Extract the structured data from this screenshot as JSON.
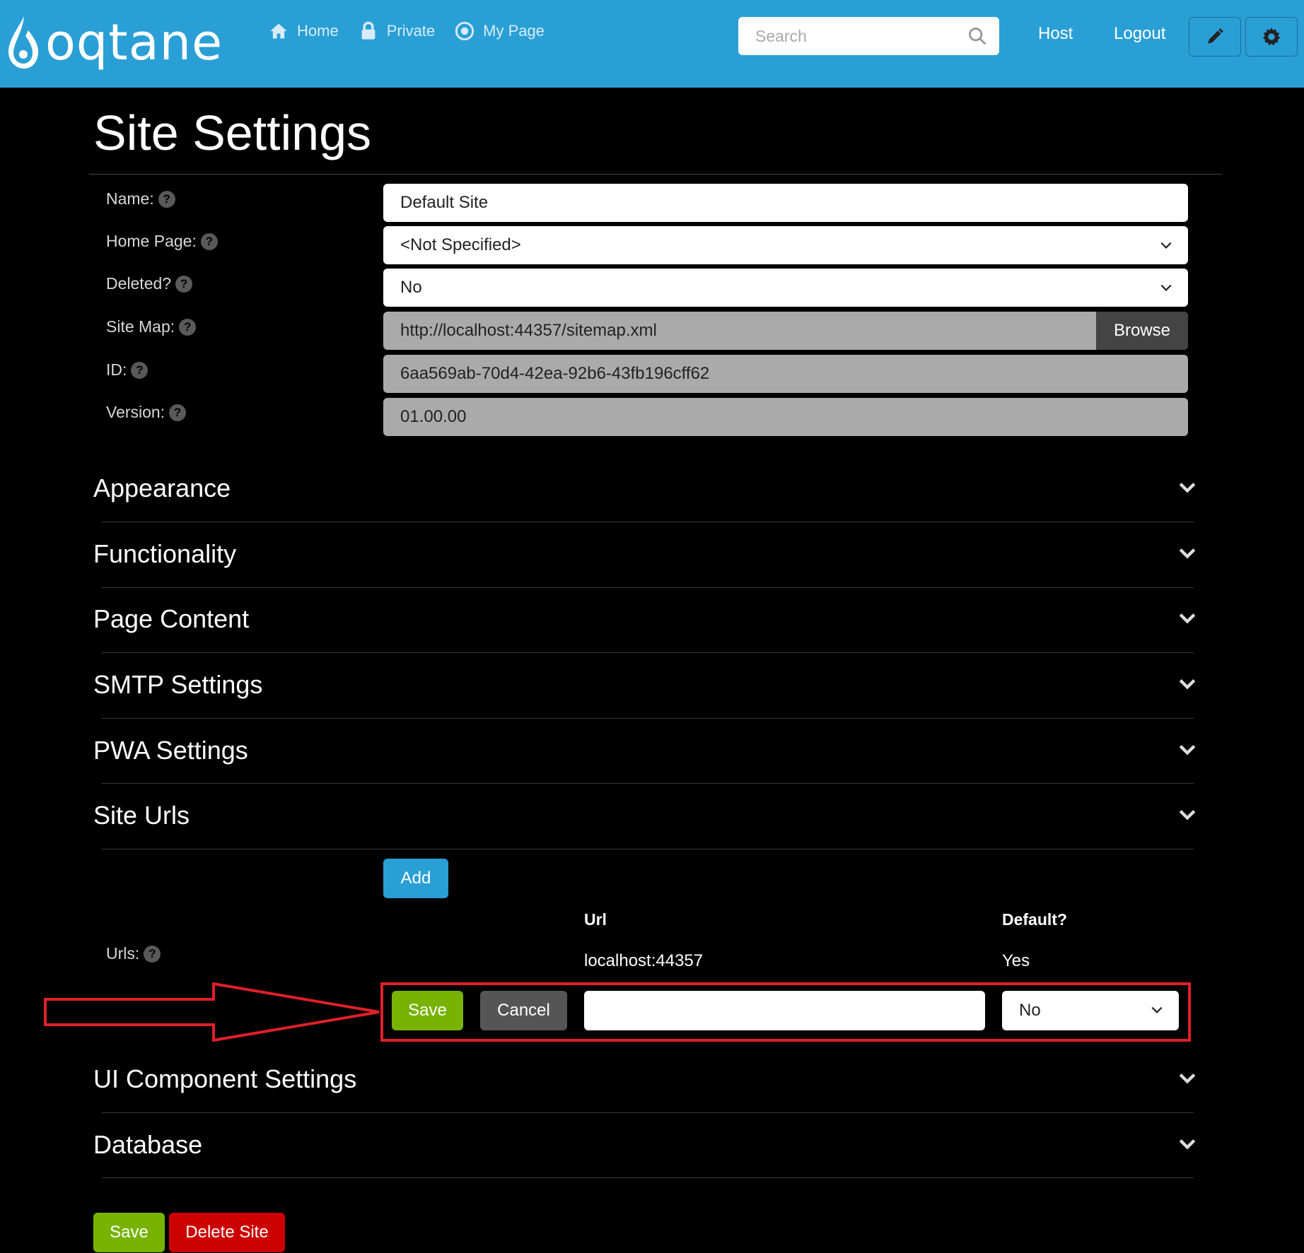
{
  "navbar": {
    "logo_text": "oqtane",
    "links": [
      {
        "label": "Home",
        "icon": "home-icon"
      },
      {
        "label": "Private",
        "icon": "lock-icon"
      },
      {
        "label": "My Page",
        "icon": "target-icon"
      }
    ],
    "search_placeholder": "Search",
    "host_label": "Host",
    "logout_label": "Logout",
    "edit_icon": "pencil-icon",
    "settings_icon": "gear-icon",
    "background_color": "#2a9fd6"
  },
  "page": {
    "title": "Site Settings"
  },
  "form": {
    "name": {
      "label": "Name:",
      "value": "Default Site"
    },
    "home_page": {
      "label": "Home Page:",
      "value": "<Not Specified>"
    },
    "deleted": {
      "label": "Deleted?",
      "value": "No"
    },
    "site_map": {
      "label": "Site Map:",
      "value": "http://localhost:44357/sitemap.xml",
      "button": "Browse"
    },
    "id": {
      "label": "ID:",
      "value": "6aa569ab-70d4-42ea-92b6-43fb196cff62"
    },
    "version": {
      "label": "Version:",
      "value": "01.00.00"
    }
  },
  "sections": [
    "Appearance",
    "Functionality",
    "Page Content",
    "SMTP Settings",
    "PWA Settings",
    "Site Urls",
    "UI Component Settings",
    "Database"
  ],
  "site_urls": {
    "add_label": "Add",
    "urls_label": "Urls:",
    "col_url": "Url",
    "col_default": "Default?",
    "rows": [
      {
        "url": "localhost:44357",
        "default": "Yes"
      }
    ],
    "edit_row": {
      "save_label": "Save",
      "cancel_label": "Cancel",
      "url_value": "",
      "default_value": "No"
    }
  },
  "footer": {
    "save_label": "Save",
    "delete_label": "Delete Site"
  },
  "colors": {
    "green": "#77b300",
    "red": "#cc0000",
    "blue": "#2a9fd6",
    "annotation_red": "#e0202a"
  }
}
